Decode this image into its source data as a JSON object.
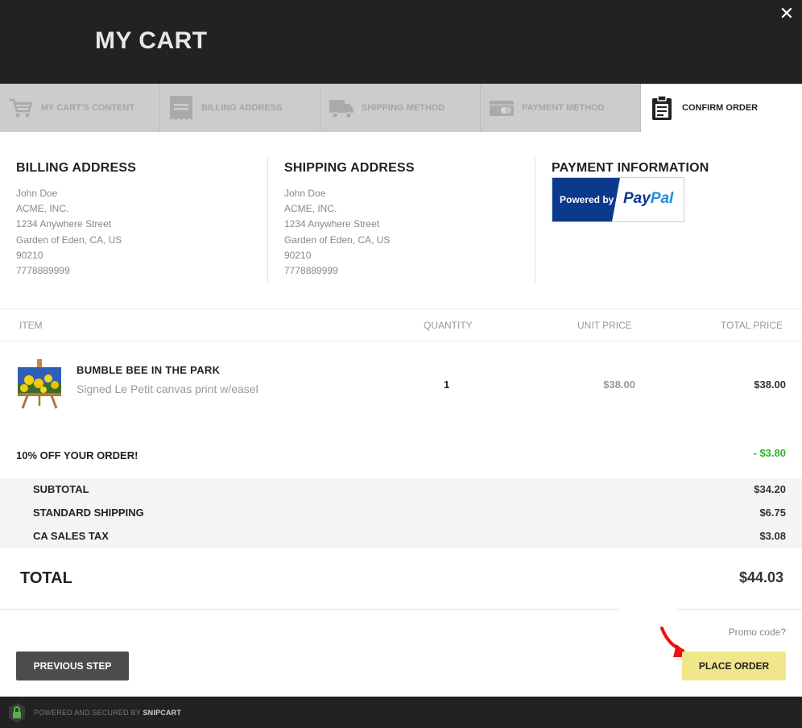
{
  "header": {
    "title": "MY CART",
    "close_icon": "close-icon"
  },
  "steps": [
    {
      "label": "MY CART'S CONTENT",
      "icon": "cart-icon"
    },
    {
      "label": "BILLING ADDRESS",
      "icon": "receipt-icon"
    },
    {
      "label": "SHIPPING METHOD",
      "icon": "truck-icon"
    },
    {
      "label": "PAYMENT METHOD",
      "icon": "credit-card-icon"
    },
    {
      "label": "CONFIRM ORDER",
      "icon": "clipboard-icon",
      "active": true
    }
  ],
  "billing": {
    "heading": "BILLING ADDRESS",
    "lines": [
      "John Doe",
      "ACME, INC.",
      "1234 Anywhere Street",
      "Garden of Eden, CA, US",
      "90210",
      "7778889999"
    ]
  },
  "shipping": {
    "heading": "SHIPPING ADDRESS",
    "lines": [
      "John Doe",
      "ACME, INC.",
      "1234 Anywhere Street",
      "Garden of Eden, CA, US",
      "90210",
      "7778889999"
    ]
  },
  "payment": {
    "heading": "PAYMENT INFORMATION",
    "badge_powered": "Powered by",
    "badge_brand_a": "Pay",
    "badge_brand_b": "Pal"
  },
  "table": {
    "headers": {
      "item": "ITEM",
      "quantity": "QUANTITY",
      "unit_price": "UNIT PRICE",
      "total_price": "TOTAL PRICE"
    },
    "items": [
      {
        "name": "BUMBLE BEE IN THE PARK",
        "description": "Signed Le Petit canvas print w/easel",
        "quantity": "1",
        "unit_price": "$38.00",
        "total": "$38.00"
      }
    ]
  },
  "discount": {
    "label": "10% OFF YOUR ORDER!",
    "value": "- $3.80"
  },
  "summary": [
    {
      "label": "SUBTOTAL",
      "value": "$34.20"
    },
    {
      "label": "STANDARD SHIPPING",
      "value": "$6.75"
    },
    {
      "label": "CA SALES TAX",
      "value": "$3.08"
    }
  ],
  "total": {
    "label": "TOTAL",
    "value": "$44.03"
  },
  "promo_link": "Promo code?",
  "buttons": {
    "previous": "PREVIOUS STEP",
    "place_order": "PLACE ORDER"
  },
  "footer": {
    "prefix": "POWERED AND SECURED BY",
    "brand": "SNIPCART"
  },
  "colors": {
    "header_bg": "#222222",
    "step_bg": "#cccccc",
    "discount": "#2ab52a",
    "place_order_bg": "#f0e68c",
    "arrow": "#ee1111"
  }
}
